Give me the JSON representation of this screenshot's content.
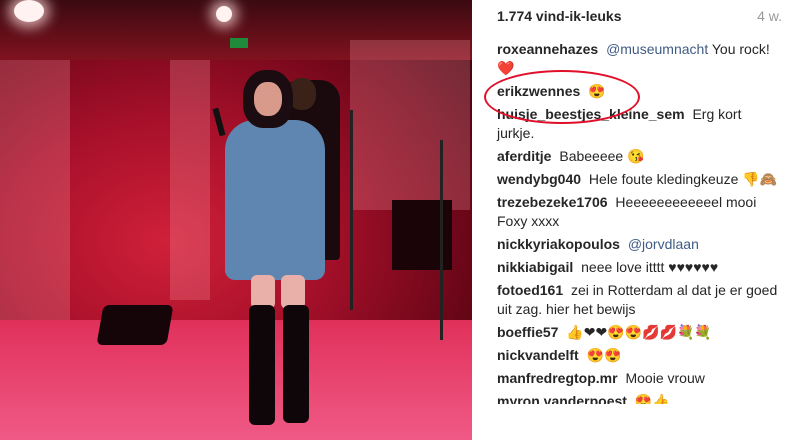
{
  "photo": {
    "exit_sign_color": "#1f8a3a",
    "accent": "#c8102e"
  },
  "post": {
    "likes": "1.774 vind-ik-leuks",
    "posted_ago": "4 w."
  },
  "comments": [
    {
      "user": "roxeannehazes",
      "mention": "@museumnacht",
      "text": "You rock! ❤️"
    },
    {
      "user": "erikzwennes",
      "mention": "",
      "text": "😍"
    },
    {
      "user": "huisje_beestjes_kleine_sem",
      "mention": "",
      "text": "Erg kort jurkje."
    },
    {
      "user": "aferditje",
      "mention": "",
      "text": "Babeeeee 😘"
    },
    {
      "user": "wendybg040",
      "mention": "",
      "text": "Hele foute kledingkeuze 👎🙈"
    },
    {
      "user": "trezebezeke1706",
      "mention": "",
      "text": "Heeeeeeeeeeeel mooi Foxy xxxx"
    },
    {
      "user": "nickkyriakopoulos",
      "mention": "@jorvdlaan",
      "text": ""
    },
    {
      "user": "nikkiabigail",
      "mention": "",
      "text": "neee love itttt ♥♥♥♥♥♥"
    },
    {
      "user": "fotoed161",
      "mention": "",
      "text": "zei in Rotterdam al dat je er goed uit zag. hier het bewijs"
    },
    {
      "user": "boeffie57",
      "mention": "",
      "text": "👍❤❤😍😍💋💋💐💐"
    },
    {
      "user": "nickvandelft",
      "mention": "",
      "text": "😍😍"
    },
    {
      "user": "manfredregtop.mr",
      "mention": "",
      "text": "Mooie vrouw"
    },
    {
      "user": "myron.vanderpoest",
      "mention": "",
      "text": "😍👍"
    }
  ]
}
